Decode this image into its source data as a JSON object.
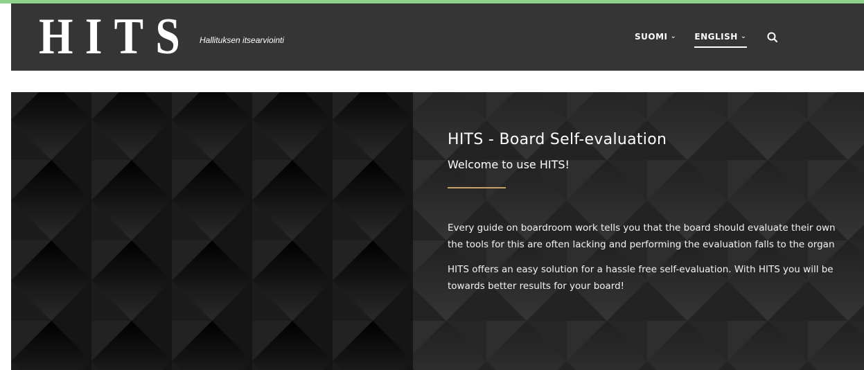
{
  "colors": {
    "accent_strip": "#8fd18b",
    "header_bg": "#353535",
    "hero_bg": "#101010",
    "divider": "#c8a165",
    "text": "#ffffff"
  },
  "header": {
    "logo_text": "HITS",
    "tagline": "Hallituksen itsearviointi",
    "nav": [
      {
        "label": "SUOMI",
        "icon": "chevron-down-icon",
        "active": false
      },
      {
        "label": "ENGLISH",
        "icon": "chevron-down-icon",
        "active": true
      }
    ],
    "search_icon": "search-icon"
  },
  "hero": {
    "title": "HITS - Board Self-evaluation",
    "subtitle": "Welcome to use HITS!",
    "paragraphs": [
      [
        "Every guide on boardroom work tells you that the board should evaluate their own",
        "the tools for this are often lacking and performing the evaluation falls to the organ"
      ],
      [
        "HITS offers an easy solution for a hassle free self-evaluation. With HITS you will be",
        "towards better results for your board!"
      ]
    ]
  }
}
